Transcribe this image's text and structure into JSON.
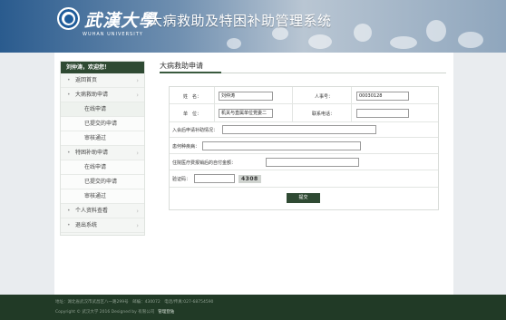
{
  "header": {
    "univ_name": "武漢大學",
    "univ_en": "WUHAN UNIVERSITY",
    "system_title": "大病救助及特困补助管理系统"
  },
  "sidebar": {
    "greeting": "刘仲涛，欢迎您！",
    "items": [
      {
        "label": "返回首页",
        "level": 1
      },
      {
        "label": "大病救助申请",
        "level": 1
      },
      {
        "label": "在线申请",
        "level": 2
      },
      {
        "label": "已提交的申请",
        "level": 2
      },
      {
        "label": "审核通过",
        "level": 2
      },
      {
        "label": "特困补助申请",
        "level": 1
      },
      {
        "label": "在线申请",
        "level": 2
      },
      {
        "label": "已提交的申请",
        "level": 2
      },
      {
        "label": "审核通过",
        "level": 2
      },
      {
        "label": "个人资料查看",
        "level": 1
      },
      {
        "label": "退出系统",
        "level": 1
      }
    ]
  },
  "content": {
    "title": "大病救助申请"
  },
  "form": {
    "name_label": "姓　名：",
    "name_value": "刘仲涛",
    "staff_no_label": "人事号：",
    "staff_no_value": "00030128",
    "unit_label": "单　位：",
    "unit_value": "机关与直属单位党委二",
    "phone_label": "联系电话：",
    "phone_value": "",
    "prior_aid_label": "入会后申请补助情况：",
    "prior_aid_value": "",
    "illness_label": "患何种疾病：",
    "illness_value": "",
    "expense_label": "住院医疗费报销后的自付金额：",
    "expense_value": "",
    "captcha_label": "验证码：",
    "captcha_value": "",
    "captcha_code": "4308",
    "submit_label": "提交"
  },
  "footer": {
    "line1": "地址：湖北省武汉市武昌区八一路299号　邮编：430072　电话/传真:027-68754590",
    "line2": "Copyright © 武汉大学 2016 Designed by 有限公司",
    "admin_link": "管理登陆"
  }
}
